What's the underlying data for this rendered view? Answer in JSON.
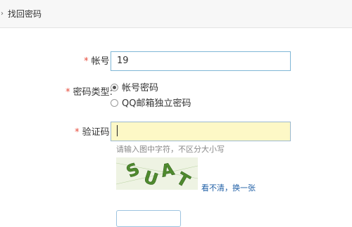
{
  "breadcrumb": {
    "arrow": "›",
    "title": "找回密码"
  },
  "form": {
    "account": {
      "required_mark": "*",
      "label": "帐号:",
      "value": "19"
    },
    "pwd_type": {
      "required_mark": "*",
      "label": "密码类型:",
      "options": [
        {
          "label": "帐号密码",
          "selected": true
        },
        {
          "label": "QQ邮箱独立密码",
          "selected": false
        }
      ]
    },
    "captcha": {
      "required_mark": "*",
      "label": "验证码:",
      "value": "",
      "hint": "请输入图中字符，不区分大小写",
      "image_text": "SUAT",
      "change_link": "看不清，换一张"
    }
  },
  "colors": {
    "required": "#e64b3b",
    "input_border": "#7fb6d6",
    "captcha_input_bg": "#fdf8c6",
    "captcha_bg": "#eef3e3",
    "captcha_text": "#4f8a2e",
    "link": "#1f5fa6"
  }
}
